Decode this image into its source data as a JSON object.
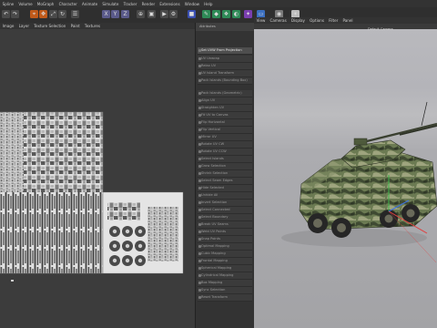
{
  "menubar": {
    "items": [
      "Spline",
      "Volume",
      "MoGraph",
      "Character",
      "Animate",
      "Simulate",
      "Tracker",
      "Render",
      "Extensions",
      "Window",
      "Help"
    ]
  },
  "toolbar": {
    "icons": [
      "undo-icon",
      "redo-icon",
      "select-icon",
      "move-icon",
      "scale-icon",
      "rotate-icon",
      "recent-icon",
      "x-axis-icon",
      "y-axis-icon",
      "z-axis-icon",
      "coordinate-icon",
      "render-view-icon",
      "render-icon",
      "render-settings-icon",
      "cube-icon",
      "pen-icon",
      "subdivision-icon",
      "cloner-icon",
      "deformer-icon",
      "field-icon",
      "floor-icon",
      "camera-icon",
      "light-icon"
    ]
  },
  "uv_editor": {
    "menu": [
      "Image",
      "Layer",
      "Texture Selection",
      "Paint",
      "Textures"
    ],
    "image_name": "tex_grnr_albedo"
  },
  "side_panel": {
    "title": "Attributes",
    "items": [
      "Set UVW From Projection",
      "UV Unwrap",
      "Relax UV",
      "UV Island Transform",
      "Pack Islands (Bounding Box)",
      "Pack Islands (Geometric)",
      "Align UV",
      "Straighten UV",
      "Fit UV to Canvas",
      "Flip Horizontal",
      "Flip Vertical",
      "Mirror UV",
      "Rotate UV CW",
      "Rotate UV CCW",
      "Select Islands",
      "Grow Selection",
      "Shrink Selection",
      "Select Seam Edges",
      "Hide Selected",
      "Unhide All",
      "Invert Selection",
      "Select Connected",
      "Select Boundary",
      "Break UV Seams",
      "Weld UV Points",
      "Snap Points",
      "Optimal Mapping",
      "Cubic Mapping",
      "Frontal Mapping",
      "Spherical Mapping",
      "Cylindrical Mapping",
      "Box Mapping",
      "Sync Selection",
      "Reset Transform"
    ],
    "selected_index": 0
  },
  "viewport": {
    "menu": [
      "View",
      "Cameras",
      "Display",
      "Options",
      "Filter",
      "Panel"
    ],
    "camera": "Default Camera",
    "object": "armored-vehicle"
  },
  "colors": {
    "accent": "#e07a1c",
    "camo_dark": "#3f4a32",
    "camo_mid": "#6b7a52",
    "camo_light": "#9ea47e"
  }
}
